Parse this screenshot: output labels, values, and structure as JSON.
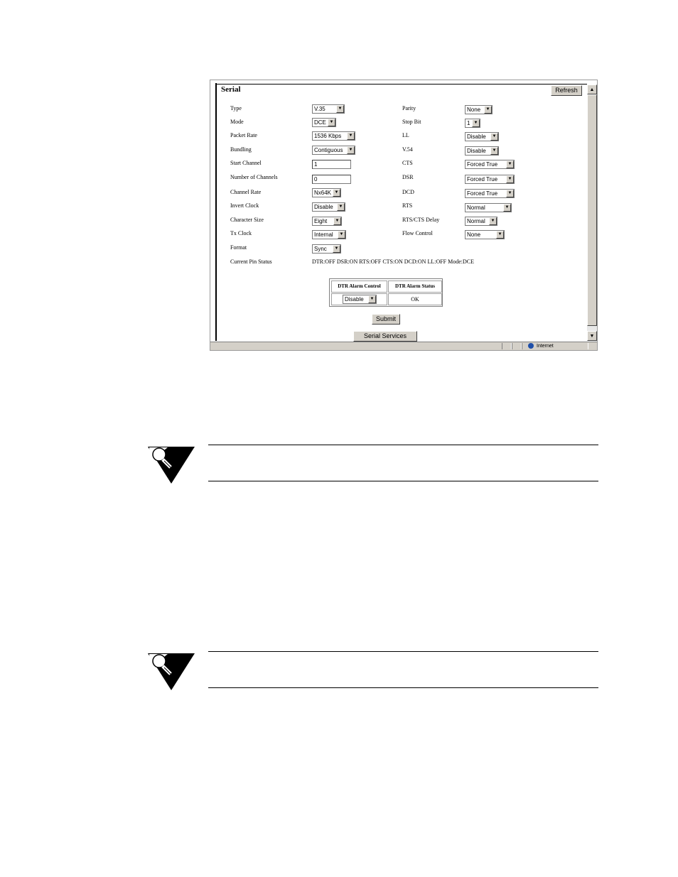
{
  "panel": {
    "title": "Serial",
    "refresh_label": "Refresh"
  },
  "left_fields": [
    {
      "label": "Type",
      "value": "V.35",
      "kind": "select"
    },
    {
      "label": "Mode",
      "value": "DCE",
      "kind": "select"
    },
    {
      "label": "Packet Rate",
      "value": "1536 Kbps",
      "kind": "select"
    },
    {
      "label": "Bundling",
      "value": "Contiguous",
      "kind": "select"
    },
    {
      "label": "Start Channel",
      "value": "1",
      "kind": "input"
    },
    {
      "label": "Number of Channels",
      "value": "0",
      "kind": "input"
    },
    {
      "label": "Channel Rate",
      "value": "Nx64K",
      "kind": "select"
    },
    {
      "label": "Invert Clock",
      "value": "Disable",
      "kind": "select"
    },
    {
      "label": "Character Size",
      "value": "Eight",
      "kind": "select"
    },
    {
      "label": "Tx Clock",
      "value": "Internal",
      "kind": "select"
    },
    {
      "label": "Format",
      "value": "Sync",
      "kind": "select"
    }
  ],
  "right_fields": [
    {
      "label": "Parity",
      "value": "None"
    },
    {
      "label": "Stop Bit",
      "value": "1"
    },
    {
      "label": "LL",
      "value": "Disable"
    },
    {
      "label": "V.54",
      "value": "Disable"
    },
    {
      "label": "CTS",
      "value": "Forced True"
    },
    {
      "label": "DSR",
      "value": "Forced True"
    },
    {
      "label": "DCD",
      "value": "Forced True"
    },
    {
      "label": "RTS",
      "value": "Normal"
    },
    {
      "label": "RTS/CTS Delay",
      "value": "Normal"
    },
    {
      "label": "Flow Control",
      "value": "None"
    }
  ],
  "pin_status": {
    "label": "Current Pin Status",
    "value": "DTR:OFF DSR:ON RTS:OFF CTS:ON DCD:ON LL:OFF Mode:DCE"
  },
  "dtr_table": {
    "headers": [
      "DTR Alarm Control",
      "DTR Alarm Status"
    ],
    "control_value": "Disable",
    "status_value": "OK"
  },
  "submit_label": "Submit",
  "serial_services_label": "Serial Services",
  "statusbar": {
    "zone": "Internet"
  },
  "icons": {
    "scroll_up": "triangle-up-icon",
    "scroll_down": "triangle-down-icon",
    "dropdown": "triangle-down-icon",
    "zone": "globe-icon",
    "note": "lightbulb-note-icon"
  }
}
